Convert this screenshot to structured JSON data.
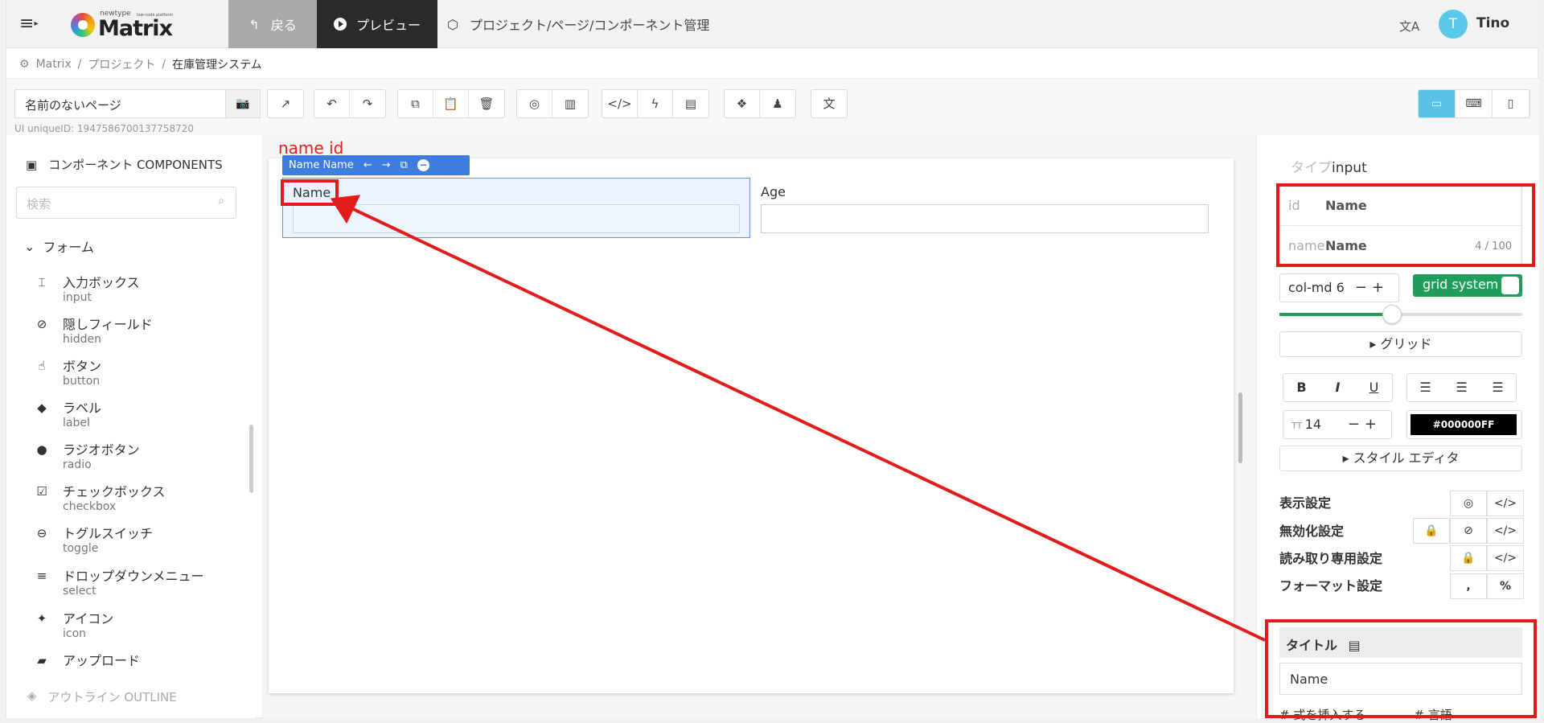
{
  "header": {
    "brand_top": "newtype",
    "brand_tag": "low-code platform",
    "brand_name": "Matrix",
    "back_label": "戻る",
    "preview_label": "プレビュー",
    "page_title": "プロジェクト/ページ/コンポーネント管理",
    "avatar_initial": "T",
    "user_name": "Tino"
  },
  "breadcrumb": [
    "Matrix",
    "プロジェクト",
    "在庫管理システム"
  ],
  "toolbar": {
    "page_name": "名前のないページ",
    "uid": "UI uniqueID: 1947586700137758720",
    "active_device": "desktop"
  },
  "left_panel": {
    "title": "コンポーネント COMPONENTS",
    "search_placeholder": "検索",
    "group": "フォーム",
    "items": [
      {
        "jp": "入力ボックス",
        "en": "input",
        "icon": "input-icon"
      },
      {
        "jp": "隠しフィールド",
        "en": "hidden",
        "icon": "hidden-icon"
      },
      {
        "jp": "ボタン",
        "en": "button",
        "icon": "pointer-icon"
      },
      {
        "jp": "ラベル",
        "en": "label",
        "icon": "tag-icon"
      },
      {
        "jp": "ラジオボタン",
        "en": "radio",
        "icon": "radio-icon"
      },
      {
        "jp": "チェックボックス",
        "en": "checkbox",
        "icon": "checkbox-icon"
      },
      {
        "jp": "トグルスイッチ",
        "en": "toggle",
        "icon": "toggle-icon"
      },
      {
        "jp": "ドロップダウンメニュー",
        "en": "select",
        "icon": "list-icon"
      },
      {
        "jp": "アイコン",
        "en": "icon",
        "icon": "shapes-icon"
      },
      {
        "jp": "アップロード",
        "en": "",
        "icon": "folder-icon"
      }
    ],
    "outline": "アウトライン OUTLINE"
  },
  "canvas": {
    "annotation": "name   id",
    "selected_bar": "Name Name",
    "field1_label": "Name",
    "field2_label": "Age"
  },
  "right_panel": {
    "type_key": "タイプ",
    "type_value": "input",
    "id_key": "id",
    "id_value": "Name",
    "name_key": "name",
    "name_value": "Name",
    "name_count": "4 / 100",
    "col_label": "col-md 6",
    "grid_system": "grid system",
    "grid_span": 6,
    "grid_btn": "グリッド",
    "font_size": "14",
    "color_value": "#000000FF",
    "style_editor": "スタイル エディタ",
    "props": [
      "表示設定",
      "無効化設定",
      "読み取り専用設定",
      "フォーマット設定"
    ],
    "title_label": "タイトル",
    "title_value": "Name",
    "bottom_left": "式を挿入する",
    "bottom_right": "言語"
  },
  "colors": {
    "accent": "#5bc2e7",
    "selection": "#3d7de0",
    "annotation": "#e21b1b",
    "toggle": "#1e9e5a"
  }
}
